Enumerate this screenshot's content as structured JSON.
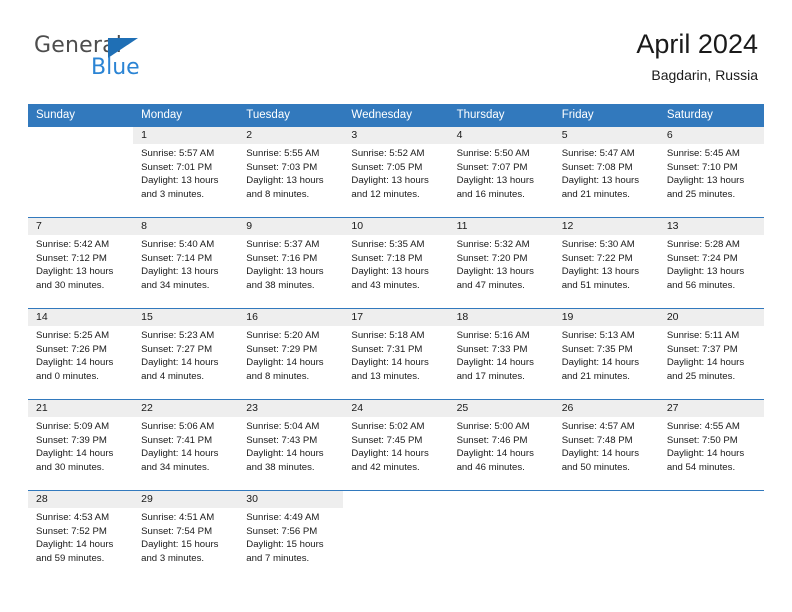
{
  "brand": {
    "name_top": "General",
    "name_bottom": "Blue",
    "triangle_icon": "blue-triangle-logo-icon",
    "color_top": "#4d4d4d",
    "color_bottom": "#2b84d4"
  },
  "header": {
    "title": "April 2024",
    "subtitle": "Bagdarin, Russia"
  },
  "theme": {
    "header_bg": "#3279bd",
    "header_text": "#ffffff",
    "daynum_band_bg": "#eeeeee",
    "cell_bg": "#ffffff",
    "divider": "#3279bd"
  },
  "labels": {
    "sunrise_prefix": "Sunrise:",
    "sunset_prefix": "Sunset:",
    "daylight_prefix": "Daylight:"
  },
  "columns": [
    "Sunday",
    "Monday",
    "Tuesday",
    "Wednesday",
    "Thursday",
    "Friday",
    "Saturday"
  ],
  "weeks": [
    [
      {
        "day": "",
        "lines": []
      },
      {
        "day": "1",
        "lines": [
          "Sunrise: 5:57 AM",
          "Sunset: 7:01 PM",
          "Daylight: 13 hours",
          "and 3 minutes."
        ]
      },
      {
        "day": "2",
        "lines": [
          "Sunrise: 5:55 AM",
          "Sunset: 7:03 PM",
          "Daylight: 13 hours",
          "and 8 minutes."
        ]
      },
      {
        "day": "3",
        "lines": [
          "Sunrise: 5:52 AM",
          "Sunset: 7:05 PM",
          "Daylight: 13 hours",
          "and 12 minutes."
        ]
      },
      {
        "day": "4",
        "lines": [
          "Sunrise: 5:50 AM",
          "Sunset: 7:07 PM",
          "Daylight: 13 hours",
          "and 16 minutes."
        ]
      },
      {
        "day": "5",
        "lines": [
          "Sunrise: 5:47 AM",
          "Sunset: 7:08 PM",
          "Daylight: 13 hours",
          "and 21 minutes."
        ]
      },
      {
        "day": "6",
        "lines": [
          "Sunrise: 5:45 AM",
          "Sunset: 7:10 PM",
          "Daylight: 13 hours",
          "and 25 minutes."
        ]
      }
    ],
    [
      {
        "day": "7",
        "lines": [
          "Sunrise: 5:42 AM",
          "Sunset: 7:12 PM",
          "Daylight: 13 hours",
          "and 30 minutes."
        ]
      },
      {
        "day": "8",
        "lines": [
          "Sunrise: 5:40 AM",
          "Sunset: 7:14 PM",
          "Daylight: 13 hours",
          "and 34 minutes."
        ]
      },
      {
        "day": "9",
        "lines": [
          "Sunrise: 5:37 AM",
          "Sunset: 7:16 PM",
          "Daylight: 13 hours",
          "and 38 minutes."
        ]
      },
      {
        "day": "10",
        "lines": [
          "Sunrise: 5:35 AM",
          "Sunset: 7:18 PM",
          "Daylight: 13 hours",
          "and 43 minutes."
        ]
      },
      {
        "day": "11",
        "lines": [
          "Sunrise: 5:32 AM",
          "Sunset: 7:20 PM",
          "Daylight: 13 hours",
          "and 47 minutes."
        ]
      },
      {
        "day": "12",
        "lines": [
          "Sunrise: 5:30 AM",
          "Sunset: 7:22 PM",
          "Daylight: 13 hours",
          "and 51 minutes."
        ]
      },
      {
        "day": "13",
        "lines": [
          "Sunrise: 5:28 AM",
          "Sunset: 7:24 PM",
          "Daylight: 13 hours",
          "and 56 minutes."
        ]
      }
    ],
    [
      {
        "day": "14",
        "lines": [
          "Sunrise: 5:25 AM",
          "Sunset: 7:26 PM",
          "Daylight: 14 hours",
          "and 0 minutes."
        ]
      },
      {
        "day": "15",
        "lines": [
          "Sunrise: 5:23 AM",
          "Sunset: 7:27 PM",
          "Daylight: 14 hours",
          "and 4 minutes."
        ]
      },
      {
        "day": "16",
        "lines": [
          "Sunrise: 5:20 AM",
          "Sunset: 7:29 PM",
          "Daylight: 14 hours",
          "and 8 minutes."
        ]
      },
      {
        "day": "17",
        "lines": [
          "Sunrise: 5:18 AM",
          "Sunset: 7:31 PM",
          "Daylight: 14 hours",
          "and 13 minutes."
        ]
      },
      {
        "day": "18",
        "lines": [
          "Sunrise: 5:16 AM",
          "Sunset: 7:33 PM",
          "Daylight: 14 hours",
          "and 17 minutes."
        ]
      },
      {
        "day": "19",
        "lines": [
          "Sunrise: 5:13 AM",
          "Sunset: 7:35 PM",
          "Daylight: 14 hours",
          "and 21 minutes."
        ]
      },
      {
        "day": "20",
        "lines": [
          "Sunrise: 5:11 AM",
          "Sunset: 7:37 PM",
          "Daylight: 14 hours",
          "and 25 minutes."
        ]
      }
    ],
    [
      {
        "day": "21",
        "lines": [
          "Sunrise: 5:09 AM",
          "Sunset: 7:39 PM",
          "Daylight: 14 hours",
          "and 30 minutes."
        ]
      },
      {
        "day": "22",
        "lines": [
          "Sunrise: 5:06 AM",
          "Sunset: 7:41 PM",
          "Daylight: 14 hours",
          "and 34 minutes."
        ]
      },
      {
        "day": "23",
        "lines": [
          "Sunrise: 5:04 AM",
          "Sunset: 7:43 PM",
          "Daylight: 14 hours",
          "and 38 minutes."
        ]
      },
      {
        "day": "24",
        "lines": [
          "Sunrise: 5:02 AM",
          "Sunset: 7:45 PM",
          "Daylight: 14 hours",
          "and 42 minutes."
        ]
      },
      {
        "day": "25",
        "lines": [
          "Sunrise: 5:00 AM",
          "Sunset: 7:46 PM",
          "Daylight: 14 hours",
          "and 46 minutes."
        ]
      },
      {
        "day": "26",
        "lines": [
          "Sunrise: 4:57 AM",
          "Sunset: 7:48 PM",
          "Daylight: 14 hours",
          "and 50 minutes."
        ]
      },
      {
        "day": "27",
        "lines": [
          "Sunrise: 4:55 AM",
          "Sunset: 7:50 PM",
          "Daylight: 14 hours",
          "and 54 minutes."
        ]
      }
    ],
    [
      {
        "day": "28",
        "lines": [
          "Sunrise: 4:53 AM",
          "Sunset: 7:52 PM",
          "Daylight: 14 hours",
          "and 59 minutes."
        ]
      },
      {
        "day": "29",
        "lines": [
          "Sunrise: 4:51 AM",
          "Sunset: 7:54 PM",
          "Daylight: 15 hours",
          "and 3 minutes."
        ]
      },
      {
        "day": "30",
        "lines": [
          "Sunrise: 4:49 AM",
          "Sunset: 7:56 PM",
          "Daylight: 15 hours",
          "and 7 minutes."
        ]
      },
      {
        "day": "",
        "lines": []
      },
      {
        "day": "",
        "lines": []
      },
      {
        "day": "",
        "lines": []
      },
      {
        "day": "",
        "lines": []
      }
    ]
  ]
}
